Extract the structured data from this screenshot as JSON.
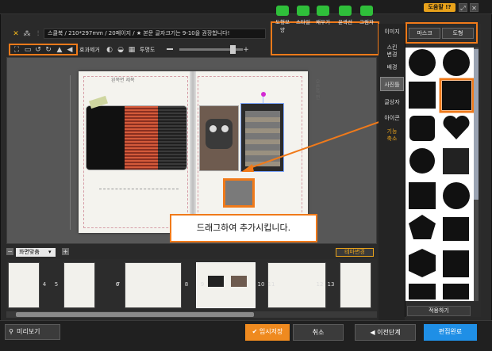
{
  "titlebar": {
    "help_label": "도움말 !?",
    "resize_icon": "resize-icon",
    "close_icon": "close-icon"
  },
  "info": {
    "text": "스쿨북 / 210*297mm / 20페이지 / ★ 본문 글자크기는 9-10을 권장합니다!"
  },
  "edit_toolbar": {
    "effect_label": "효과제거",
    "opacity_label": "투명도"
  },
  "shape_tools": {
    "items": [
      {
        "label": "도형모양",
        "icon": "shape-icon"
      },
      {
        "label": "스타일",
        "icon": "style-brush-icon"
      },
      {
        "label": "채우기",
        "icon": "fill-icon"
      },
      {
        "label": "윤곽선",
        "icon": "outline-pen-icon"
      },
      {
        "label": "그림자",
        "icon": "shadow-icon"
      }
    ]
  },
  "page": {
    "left_label": "왼쪽면 제목",
    "right_label": "오른쪽 면"
  },
  "callout": {
    "text": "드래그하여 추가시킵니다."
  },
  "thumbs_bar": {
    "zoom_value": "화면맞춤",
    "theme_label": "테마변경"
  },
  "thumbs": [
    {
      "num": "4"
    },
    {
      "num": "5"
    },
    {
      "num": "6"
    },
    {
      "num": "7"
    },
    {
      "num": "8"
    },
    {
      "num": "9"
    },
    {
      "num": "10"
    },
    {
      "num": "11"
    },
    {
      "num": "12"
    },
    {
      "num": "13"
    }
  ],
  "sidetabs": [
    {
      "label": "이미지"
    },
    {
      "label": "스킨\n변경"
    },
    {
      "label": "배경"
    },
    {
      "label": "사진틀"
    },
    {
      "label": "글상자"
    },
    {
      "label": "아이콘"
    },
    {
      "label": "기능\n축소"
    }
  ],
  "panel": {
    "tab_mask": "마스크",
    "tab_shape": "도형",
    "apply_label": "적용하기"
  },
  "bottom": {
    "preview_label": "미리보기",
    "save_label": "임시저장",
    "cancel_label": "취소",
    "prev_label": "◀ 이전단계",
    "done_label": "편집완료"
  },
  "colors": {
    "accent": "#f07a1a",
    "save": "#ef8a1f",
    "done": "#1f8fe6",
    "green": "#2fbf3a"
  }
}
